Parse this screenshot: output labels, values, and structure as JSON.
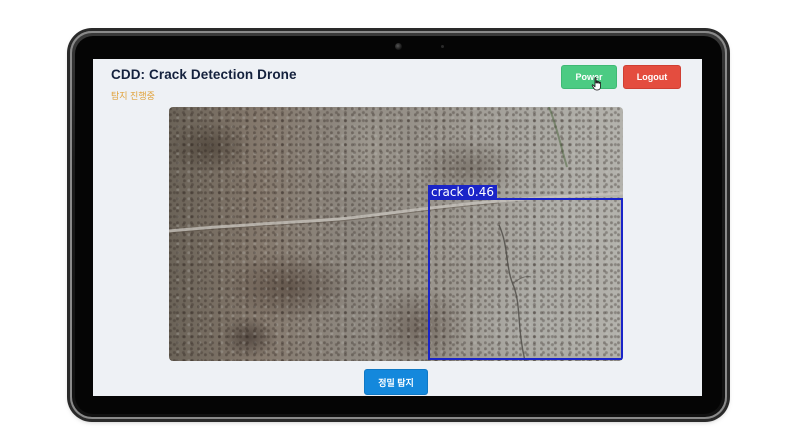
{
  "app": {
    "title": "CDD: Crack Detection Drone",
    "status": "탐지 진행중"
  },
  "header": {
    "power_label": "Power",
    "logout_label": "Logout"
  },
  "feed": {
    "detection_label": "crack  0.46",
    "detection_class": "crack",
    "detection_confidence": 0.46,
    "box_color": "#1a24c8"
  },
  "footer": {
    "inspect_label": "정밀 탐지"
  },
  "colors": {
    "title": "#14213d",
    "status": "#e1a23a",
    "power": "#4ccb83",
    "logout": "#e44d3f",
    "inspect": "#1488dc",
    "screen_bg": "#eef1f5"
  },
  "icons": {
    "cursor": "hand-pointer-icon",
    "camera": "front-camera-icon"
  }
}
